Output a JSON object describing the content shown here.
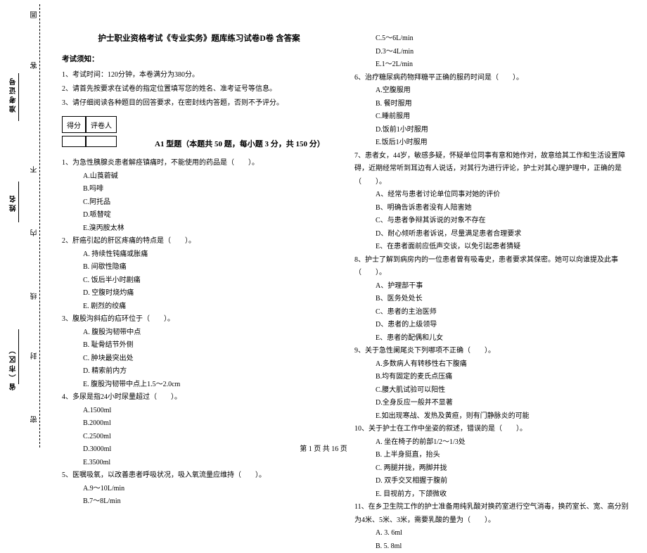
{
  "title": "护士职业资格考试《专业实务》题库练习试卷D卷 含答案",
  "notice_heading": "考试须知：",
  "instructions": [
    "1、考试时间：120分钟，本卷满分为380分。",
    "2、请首先按要求在试卷的指定位置填写您的姓名、准考证号等信息。",
    "3、请仔细阅读各种题目的回答要求，在密封线内答题，否则不予评分。"
  ],
  "score_labels": {
    "score": "得分",
    "reviewer": "评卷人"
  },
  "a1_heading": "A1 型题（本题共 50 题，每小题 3 分，共 150 分）",
  "left_questions": [
    {
      "stem": "1、为急性胰腺炎患者解痉镇痛时，不能使用的药品是（　　）。",
      "opts": [
        "A.山莨菪碱",
        "B.吗啡",
        "C.阿托品",
        "D.哌替啶",
        "E.溴丙胺太林"
      ]
    },
    {
      "stem": "2、肝癌引起的肝区疼痛的特点是（　　）。",
      "opts": [
        "A. 持续性钝痛或胀痛",
        "B. 间歇性隐痛",
        "C. 饭后半小时剧痛",
        "D. 空腹时烧灼痛",
        "E. 剧烈的绞痛"
      ]
    },
    {
      "stem": "3、腹股沟斜疝的疝环位于（　　）。",
      "opts": [
        "A. 腹股沟韧带中点",
        "B. 耻骨结节外侧",
        "C. 肿块最突出处",
        "D. 精索前内方",
        "E. 腹股沟韧带中点上1.5～2.0cm"
      ]
    },
    {
      "stem": "4、多尿是指24小时尿量超过（　　）。",
      "opts": [
        "A.1500ml",
        "B.2000ml",
        "C.2500ml",
        "D.3000ml",
        "E.3500ml"
      ]
    },
    {
      "stem": "5、医嘱吸氧，以改善患者呼吸状况，吸入氧流量应维持（　　）。",
      "opts": [
        "A.9～10L/min",
        "B.7～8L/min"
      ]
    }
  ],
  "right_top_opts": [
    "C.5～6L/min",
    "D.3～4L/min",
    "E.1～2L/min"
  ],
  "right_questions": [
    {
      "stem": "6、治疗糖尿病药物拜糖平正确的服药时间是（　　）。",
      "opts": [
        "A.空腹服用",
        "B. 餐时服用",
        "C.睡前服用",
        "D.饭前1小时服用",
        "E.饭后1小时服用"
      ]
    },
    {
      "stem": "7、患者女，44岁，敏感多疑，怀疑单位同事有意和她作对，故意给其工作和生活设置障碍，近期经常听到耳边有人说话，对其行为进行评论，护士对其心理护理中，正确的是（　　）。",
      "opts": [
        "A、经常与患者讨论单位同事对她的评价",
        "B、明确告诉患者没有人陪害她",
        "C、与患者争辩其诉说的对象不存在",
        "D、耐心倾听患者诉说，尽量满足患者合理要求",
        "E、在患者面前应低声交谈，以免引起患者猜疑"
      ]
    },
    {
      "stem": "8、护士了解到病房内的一位患者曾有吸毒史，患者要求其保密。她可以向谁提及此事（　　）。",
      "opts": [
        "A、护理部干事",
        "B、医务处处长",
        "C、患者的主治医师",
        "D、患者的上级领导",
        "E、患者的配偶和儿女"
      ]
    },
    {
      "stem": "9、关于急性阑尾炎下列哪项不正确（　　）。",
      "opts": [
        "A.多数病人有转移性右下腹痛",
        "B.均有固定的麦氏点压痛",
        "C.腰大肌试验可以阳性",
        "D.全身反应一般并不显著",
        "E.如出现寒战、发热及黄疸，则有门静脉炎的可能"
      ]
    },
    {
      "stem": "10、关于护士在工作中坐姿的叙述，错误的是（　　）。",
      "opts": [
        "A. 坐在椅子的前部1/2～1/3处",
        "B. 上半身挺直，抬头",
        "C. 两腿并拢，两脚并拢",
        "D. 双手交叉相握于腹前",
        "E. 目视前方，下颌微收"
      ]
    },
    {
      "stem": "11、在乡卫生院工作的护士准备用纯乳酸对换药室进行空气消毒，换药室长、宽、高分别为4米、5米、3米，需要乳酸的量为（　　）。",
      "opts": [
        "A. 3. 6ml",
        "B. 5. 8ml"
      ]
    }
  ],
  "binding": {
    "circle": "圆",
    "ke": "客",
    "admit_label": "准考证号",
    "bu": "不",
    "name_label": "姓名",
    "nei": "内",
    "xian": "线",
    "feng": "封",
    "province_label": "省（市区）",
    "mi": "密"
  },
  "footer": "第 1 页 共 16 页"
}
